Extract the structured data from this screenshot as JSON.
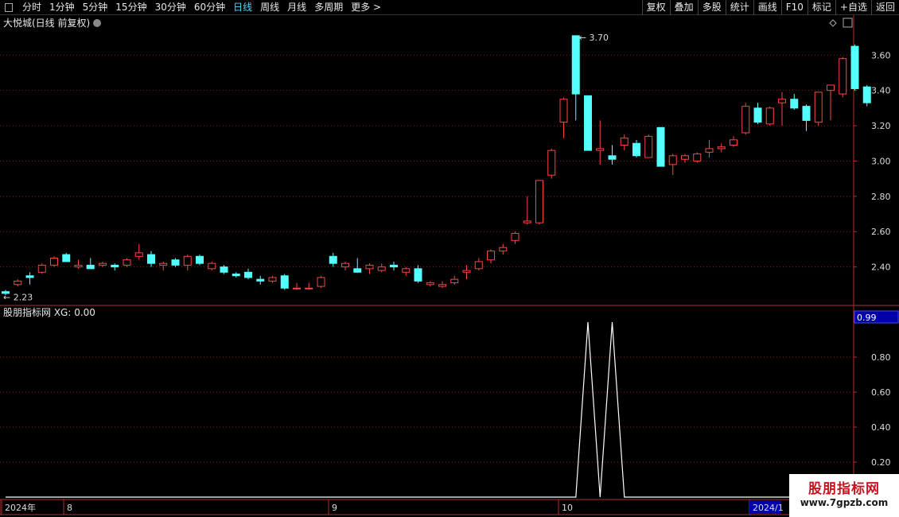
{
  "toolbar": {
    "periods": [
      "分时",
      "1分钟",
      "5分钟",
      "15分钟",
      "30分钟",
      "60分钟",
      "日线",
      "周线",
      "月线",
      "多周期",
      "更多 >"
    ],
    "active_period": "日线",
    "buttons": [
      "复权",
      "叠加",
      "多股",
      "统计",
      "画线",
      "F10",
      "标记",
      "+自选",
      "返回"
    ]
  },
  "main_pane": {
    "title": "大悦城(日线 前复权)",
    "high_label": "3.70",
    "low_label": "2.23"
  },
  "indicator_pane": {
    "title": "股朋指标网 XG: 0.00",
    "current_value": "0.99"
  },
  "date_axis": {
    "labels": [
      "2024年",
      "8",
      "9",
      "10",
      "2024/1"
    ]
  },
  "watermark": {
    "title": "股朋指标网",
    "url": "www.7gpzb.com"
  },
  "colors": {
    "up": "#ff4444",
    "down": "#54ffff",
    "grid": "#8b1a1a",
    "axis": "#b03030",
    "indicator_line": "#ffffff",
    "highlight_box": "#0000aa"
  },
  "chart_data": [
    {
      "type": "candlestick",
      "title": "大悦城(日线 前复权)",
      "y_ticks": [
        "3.60",
        "3.40",
        "3.20",
        "3.00",
        "2.80",
        "2.60",
        "2.40"
      ],
      "ylim": [
        2.2,
        3.75
      ],
      "candles": [
        [
          2.26,
          2.27,
          2.24,
          2.25
        ],
        [
          2.3,
          2.33,
          2.29,
          2.32
        ],
        [
          2.35,
          2.37,
          2.3,
          2.34
        ],
        [
          2.37,
          2.42,
          2.36,
          2.41
        ],
        [
          2.41,
          2.46,
          2.4,
          2.45
        ],
        [
          2.47,
          2.48,
          2.43,
          2.43
        ],
        [
          2.4,
          2.44,
          2.39,
          2.41
        ],
        [
          2.41,
          2.45,
          2.39,
          2.39
        ],
        [
          2.41,
          2.43,
          2.4,
          2.42
        ],
        [
          2.41,
          2.42,
          2.38,
          2.4
        ],
        [
          2.41,
          2.45,
          2.4,
          2.44
        ],
        [
          2.46,
          2.53,
          2.44,
          2.48
        ],
        [
          2.47,
          2.49,
          2.4,
          2.42
        ],
        [
          2.41,
          2.43,
          2.38,
          2.42
        ],
        [
          2.44,
          2.45,
          2.4,
          2.41
        ],
        [
          2.41,
          2.47,
          2.38,
          2.46
        ],
        [
          2.46,
          2.47,
          2.41,
          2.42
        ],
        [
          2.39,
          2.43,
          2.38,
          2.42
        ],
        [
          2.4,
          2.41,
          2.36,
          2.37
        ],
        [
          2.36,
          2.37,
          2.34,
          2.35
        ],
        [
          2.37,
          2.39,
          2.33,
          2.34
        ],
        [
          2.33,
          2.35,
          2.3,
          2.32
        ],
        [
          2.32,
          2.35,
          2.31,
          2.34
        ],
        [
          2.35,
          2.36,
          2.27,
          2.28
        ],
        [
          2.28,
          2.31,
          2.27,
          2.28
        ],
        [
          2.28,
          2.31,
          2.27,
          2.28
        ],
        [
          2.29,
          2.35,
          2.28,
          2.34
        ],
        [
          2.46,
          2.48,
          2.4,
          2.42
        ],
        [
          2.4,
          2.43,
          2.38,
          2.42
        ],
        [
          2.39,
          2.45,
          2.37,
          2.37
        ],
        [
          2.39,
          2.42,
          2.36,
          2.41
        ],
        [
          2.38,
          2.42,
          2.37,
          2.4
        ],
        [
          2.41,
          2.43,
          2.38,
          2.4
        ],
        [
          2.37,
          2.4,
          2.35,
          2.39
        ],
        [
          2.39,
          2.41,
          2.31,
          2.32
        ],
        [
          2.3,
          2.32,
          2.29,
          2.31
        ],
        [
          2.29,
          2.32,
          2.28,
          2.3
        ],
        [
          2.31,
          2.35,
          2.3,
          2.33
        ],
        [
          2.37,
          2.41,
          2.33,
          2.38
        ],
        [
          2.39,
          2.45,
          2.38,
          2.43
        ],
        [
          2.44,
          2.5,
          2.42,
          2.49
        ],
        [
          2.49,
          2.53,
          2.47,
          2.51
        ],
        [
          2.55,
          2.6,
          2.53,
          2.59
        ],
        [
          2.65,
          2.8,
          2.64,
          2.66
        ],
        [
          2.65,
          2.89,
          2.64,
          2.89
        ],
        [
          2.92,
          3.07,
          2.9,
          3.06
        ],
        [
          3.22,
          3.36,
          3.13,
          3.35
        ],
        [
          3.71,
          3.71,
          3.23,
          3.38
        ],
        [
          3.37,
          3.37,
          3.06,
          3.06
        ],
        [
          3.06,
          3.23,
          2.98,
          3.07
        ],
        [
          3.03,
          3.09,
          2.98,
          3.01
        ],
        [
          3.09,
          3.15,
          3.06,
          3.13
        ],
        [
          3.1,
          3.12,
          3.02,
          3.03
        ],
        [
          3.02,
          3.15,
          3.02,
          3.14
        ],
        [
          3.19,
          3.19,
          2.97,
          2.97
        ],
        [
          2.98,
          3.04,
          2.92,
          3.03
        ],
        [
          3.01,
          3.04,
          2.99,
          3.03
        ],
        [
          3.0,
          3.05,
          2.99,
          3.04
        ],
        [
          3.05,
          3.12,
          3.02,
          3.07
        ],
        [
          3.07,
          3.1,
          3.05,
          3.08
        ],
        [
          3.09,
          3.14,
          3.08,
          3.12
        ],
        [
          3.16,
          3.33,
          3.15,
          3.31
        ],
        [
          3.3,
          3.33,
          3.21,
          3.22
        ],
        [
          3.21,
          3.31,
          3.2,
          3.3
        ],
        [
          3.33,
          3.39,
          3.2,
          3.35
        ],
        [
          3.35,
          3.38,
          3.29,
          3.3
        ],
        [
          3.31,
          3.32,
          3.17,
          3.23
        ],
        [
          3.22,
          3.39,
          3.2,
          3.39
        ],
        [
          3.4,
          3.43,
          3.23,
          3.43
        ],
        [
          3.38,
          3.59,
          3.36,
          3.58
        ],
        [
          3.65,
          3.66,
          3.4,
          3.41
        ],
        [
          3.42,
          3.43,
          3.31,
          3.33
        ]
      ]
    },
    {
      "type": "line",
      "title": "股朋指标网 XG: 0.00",
      "y_ticks": [
        "0.80",
        "0.60",
        "0.40",
        "0.20"
      ],
      "ylim": [
        0,
        1
      ],
      "series": [
        {
          "values": [
            0,
            0,
            0,
            0,
            0,
            0,
            0,
            0,
            0,
            0,
            0,
            0,
            0,
            0,
            0,
            0,
            0,
            0,
            0,
            0,
            0,
            0,
            0,
            0,
            0,
            0,
            0,
            0,
            0,
            0,
            0,
            0,
            0,
            0,
            0,
            0,
            0,
            0,
            0,
            0,
            0,
            0,
            0,
            0,
            0,
            0,
            0,
            0,
            1,
            0,
            1,
            0,
            0,
            0,
            0,
            0,
            0,
            0,
            0,
            0,
            0,
            0,
            0,
            0,
            0,
            0,
            0,
            0,
            0,
            0,
            0,
            0
          ]
        }
      ]
    }
  ]
}
